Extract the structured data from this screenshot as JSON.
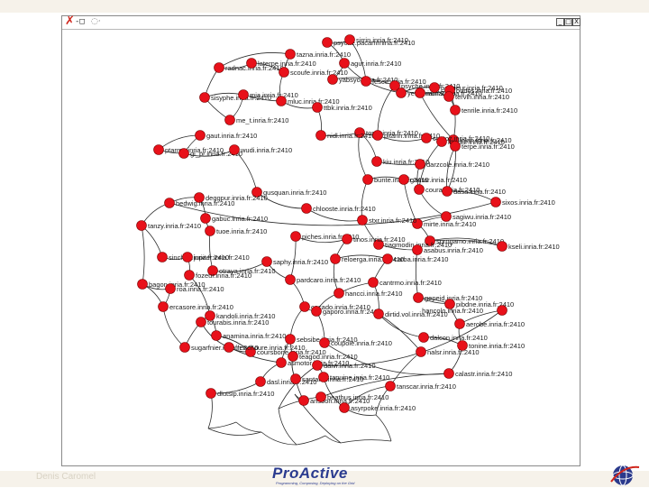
{
  "window": {
    "controls": [
      "_",
      "□",
      "X"
    ]
  },
  "footer": {
    "author": "Denis Caromel",
    "brand": "ProActive",
    "tagline": "Programming, Composing, Deploying on the Grid"
  },
  "graph": {
    "nodes": [
      {
        "id": "n0",
        "label": "psyche.pacamrnina.fr:2410"
      },
      {
        "id": "n1",
        "label": "sirrin.inria.fr:2410"
      },
      {
        "id": "n2",
        "label": "tazna.inria.fr:2410"
      },
      {
        "id": "n3",
        "label": "radnac.inria.fr:2410"
      },
      {
        "id": "n4",
        "label": "laterpe.inria.fr:2410"
      },
      {
        "id": "n5",
        "label": "agur.inria.fr:2410"
      },
      {
        "id": "n6",
        "label": "scoufe.inria.fr:2410"
      },
      {
        "id": "n7",
        "label": "yabsyo.inria.fr:2410"
      },
      {
        "id": "n8",
        "label": "fesce.inria.fr:2410"
      },
      {
        "id": "n9",
        "label": "psyche.inria.fr:2410"
      },
      {
        "id": "n10",
        "label": "sisyphe.inria.fr:2410"
      },
      {
        "id": "n11",
        "label": "mia.inria.fr:2410"
      },
      {
        "id": "n12",
        "label": "mluc.inria.fr:2410"
      },
      {
        "id": "n13",
        "label": "ttbk.inria.fr:2410"
      },
      {
        "id": "n14",
        "label": "tenrile.inria.fr:2410"
      },
      {
        "id": "n15",
        "label": "me_t.inria.fr:2410"
      },
      {
        "id": "n16",
        "label": "yeti.inria.fr:2410"
      },
      {
        "id": "n17",
        "label": "milnar.inria.fr:2410"
      },
      {
        "id": "n18",
        "label": "pagrieur.inria.fr:2410"
      },
      {
        "id": "n19",
        "label": "oudos.inria.fr:2410"
      },
      {
        "id": "n20",
        "label": "tervin.inria.fr:2410"
      },
      {
        "id": "n21",
        "label": "tomlr.inria.fr:2410"
      },
      {
        "id": "n22",
        "label": "lolan.inria.fr:2410"
      },
      {
        "id": "n23",
        "label": "nidl.inria.fr:2410"
      },
      {
        "id": "n24",
        "label": "pitarin.inria.fr:2410"
      },
      {
        "id": "n25",
        "label": "cyptoz.inria.fr:2410"
      },
      {
        "id": "n26",
        "label": "gaut.inria.fr:2410"
      },
      {
        "id": "n27",
        "label": "irrodur.inria.fr:2410"
      },
      {
        "id": "n28",
        "label": "terpe.inria.fr:2410"
      },
      {
        "id": "n29",
        "label": "ptarma.inria.fr:2410"
      },
      {
        "id": "n30",
        "label": "gi_pr.inria.fr:2410"
      },
      {
        "id": "n31",
        "label": "wudi.inria.fr:2410"
      },
      {
        "id": "n32",
        "label": "kiu.inria.fr:2410"
      },
      {
        "id": "n33",
        "label": "darzcole.inria.fr:2410"
      },
      {
        "id": "n34",
        "label": "bunte.inria.fr:2410"
      },
      {
        "id": "n35",
        "label": "gaurar.inria.fr:2410"
      },
      {
        "id": "n36",
        "label": "coura.inria.fr:2410"
      },
      {
        "id": "n37",
        "label": "dasa.inria.fr:2410"
      },
      {
        "id": "n38",
        "label": "sagiwu.inria.fr:2410"
      },
      {
        "id": "n39",
        "label": "sixos.inria.fr:2410"
      },
      {
        "id": "n40",
        "label": "gusquan.inria.fr:2410"
      },
      {
        "id": "n41",
        "label": "deggpur.inria.fr:2410"
      },
      {
        "id": "n42",
        "label": "gabuc.inria.fr:2410"
      },
      {
        "id": "n43",
        "label": "chlooste.inria.fr:2410"
      },
      {
        "id": "n44",
        "label": "mirte.inria.fr:2410"
      },
      {
        "id": "n45",
        "label": "stxr.inria.fr:2410"
      },
      {
        "id": "n46",
        "label": "hedwig.inria.fr:2410"
      },
      {
        "id": "n47",
        "label": "tanzy.inria.fr:2410"
      },
      {
        "id": "n48",
        "label": "tuoe.inria.fr:2410"
      },
      {
        "id": "n49",
        "label": "piches.inria.fr:2410"
      },
      {
        "id": "n50",
        "label": "sprogamo.inria.fr:2410"
      },
      {
        "id": "n51",
        "label": "tiagmodin.inria.fr:2410"
      },
      {
        "id": "n52",
        "label": "sinchus.inria.fr:2410"
      },
      {
        "id": "n53",
        "label": "jupiter.inria.fr:2410"
      },
      {
        "id": "n54",
        "label": "tinos.inria.fr:2410"
      },
      {
        "id": "n55",
        "label": "kseli.inria.fr:2410"
      },
      {
        "id": "n56",
        "label": "otraya.inria.fr:2410"
      },
      {
        "id": "n57",
        "label": "reloerga.inria.fr:2410"
      },
      {
        "id": "n58",
        "label": "asabus.inria.fr:2410"
      },
      {
        "id": "n59",
        "label": "saphy.inria.fr:2410"
      },
      {
        "id": "n60",
        "label": "pardcaro.inria.fr:2410"
      },
      {
        "id": "n61",
        "label": "carba.inria.fr:2410"
      },
      {
        "id": "n62",
        "label": "bagon.inria.fr:2410"
      },
      {
        "id": "n63",
        "label": "fozeur.inria.fr:2410"
      },
      {
        "id": "n64",
        "label": "cantrmo.inria.fr:2410"
      },
      {
        "id": "n65",
        "label": "hancci.inria.fr:2410"
      },
      {
        "id": "n66",
        "label": "roa.inria.fr:2410"
      },
      {
        "id": "n67",
        "label": "gepeid.inria.fr:2410"
      },
      {
        "id": "n68",
        "label": "cacado.inria.fr:2410"
      },
      {
        "id": "n69",
        "label": "gaporo.inria.fr:2410"
      },
      {
        "id": "n70",
        "label": "pibdne.inria.fr:2410"
      },
      {
        "id": "n71",
        "label": "ercasore.inria.fr:2410"
      },
      {
        "id": "n72",
        "label": "kandoli.inria.fr:2410"
      },
      {
        "id": "n73",
        "label": "tourabis.inria.fr:2410"
      },
      {
        "id": "n74",
        "label": "dirtid.vol.inria.fr:2410"
      },
      {
        "id": "n75",
        "label": "dalcon.inria.fr:2410"
      },
      {
        "id": "n76",
        "label": "hancolo.inria.fr:2410"
      },
      {
        "id": "n77",
        "label": "aerobe.inria.fr:2410"
      },
      {
        "id": "n78",
        "label": "anamina.inria.fr:2410"
      },
      {
        "id": "n79",
        "label": "sebsibe.inria.fr:2410"
      },
      {
        "id": "n80",
        "label": "sugarfnier.inria.fr:2410"
      },
      {
        "id": "n81",
        "label": "coupole.inria.fr:2410"
      },
      {
        "id": "n82",
        "label": "coursbone.inria.fr:2410"
      },
      {
        "id": "n83",
        "label": "frenchoure.inria.fr:2410"
      },
      {
        "id": "n84",
        "label": "teagod.inria.fr:2410"
      },
      {
        "id": "n85",
        "label": "tonine.inria.fr:2410"
      },
      {
        "id": "n86",
        "label": "nalsr.inria.fr:2410"
      },
      {
        "id": "n87",
        "label": "asmotor.inria.fr:2410"
      },
      {
        "id": "n88",
        "label": "dalvr.inria.fr:2410"
      },
      {
        "id": "n89",
        "label": "calastr.inria.fr:2410"
      },
      {
        "id": "n90",
        "label": "tanscar.inria.fr:2410"
      },
      {
        "id": "n91",
        "label": "dasl.inria.fr:2410"
      },
      {
        "id": "n92",
        "label": "santana.inria.fr:2410"
      },
      {
        "id": "n93",
        "label": "tapuine.inria.fr:2410"
      },
      {
        "id": "n94",
        "label": "ansbon.inria.fr:2410"
      },
      {
        "id": "n95",
        "label": "beathus.inria.fr:2410"
      },
      {
        "id": "n96",
        "label": "asyrpoke.inria.fr:2410"
      },
      {
        "id": "n97",
        "label": "dlutsip.inria.fr:2410"
      }
    ]
  }
}
